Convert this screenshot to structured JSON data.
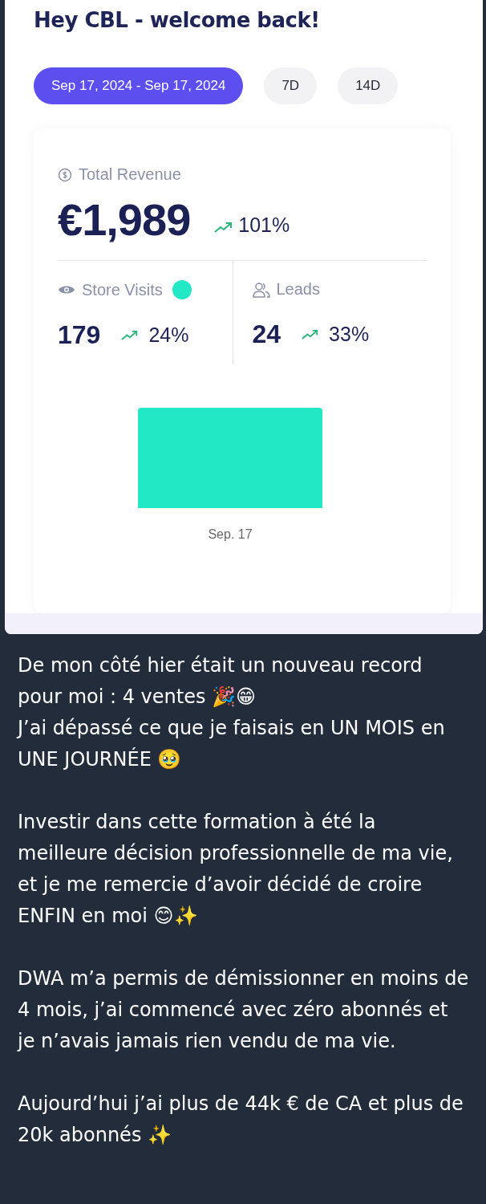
{
  "greeting": "Hey CBL - welcome back!",
  "date_filters": [
    {
      "label": "Sep 17, 2024 - Sep 17, 2024",
      "selected": true
    },
    {
      "label": "7D",
      "selected": false
    },
    {
      "label": "14D",
      "selected": false
    }
  ],
  "revenue": {
    "label": "Total Revenue",
    "value": "€1,989",
    "change": "101%"
  },
  "metrics": [
    {
      "kind": "visits",
      "label": "Store Visits",
      "color": "#22e8c6",
      "value": "179",
      "change": "24%"
    },
    {
      "kind": "leads",
      "label": "Leads",
      "value": "24",
      "change": "33%"
    }
  ],
  "chart": {
    "category": "Sep. 17"
  },
  "message": {
    "paragraphs": [
      "De mon côté hier était un nouveau record pour moi : 4 ventes 🎉😁\nJ’ai dépassé ce que je faisais en UN MOIS en UNE JOURNÉE 🥹",
      "Investir dans cette formation à été la meilleure décision professionnelle de ma vie, et je me remercie d’avoir décidé de croire ENFIN en moi 😊✨",
      "DWA m’a permis de démissionner en moins de 4 mois, j’ai commencé avec zéro abonnés et je n’avais jamais rien vendu de ma vie.",
      "Aujourd’hui j’ai plus de 44k € de CA et plus de 20k abonnés ✨"
    ]
  }
}
